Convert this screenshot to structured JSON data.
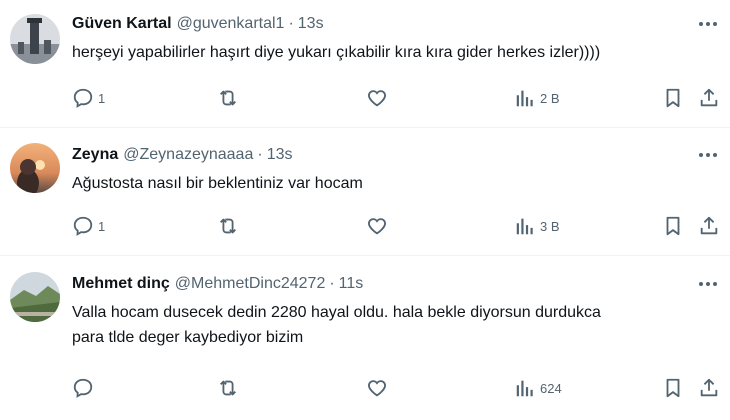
{
  "tweets": [
    {
      "name": "Güven Kartal",
      "handle": "@guvenkartal1",
      "separator": "·",
      "time": "13s",
      "text": "herşeyi yapabilirler haşırt diye yukarı çıkabilir kıra kıra gider herkes izler))))",
      "replies": "1",
      "retweets": "",
      "likes": "",
      "views": "2 B",
      "avatar_icon": "tower-photo-avatar"
    },
    {
      "name": "Zeyna",
      "handle": "@Zeynazeynaaaa",
      "separator": "·",
      "time": "13s",
      "text": "Ağustosta nasıl bir beklentiniz var hocam",
      "replies": "1",
      "retweets": "",
      "likes": "",
      "views": "3 B",
      "avatar_icon": "sunset-portrait-avatar"
    },
    {
      "name": "Mehmet dinç",
      "handle": "@MehmetDinc24272",
      "separator": "·",
      "time": "11s",
      "text": "Valla hocam dusecek dedin 2280 hayal oldu. hala bekle diyorsun durdukca\npara tlde deger kaybediyor bizim",
      "replies": "",
      "retweets": "",
      "likes": "",
      "views": "624",
      "avatar_icon": "landscape-photo-avatar"
    }
  ],
  "colors": {
    "text_primary": "#0f1419",
    "text_secondary": "#536471",
    "divider": "#eff3f4"
  },
  "icons": [
    "more-icon",
    "reply-icon",
    "retweet-icon",
    "like-icon",
    "views-icon",
    "bookmark-icon",
    "share-icon"
  ]
}
